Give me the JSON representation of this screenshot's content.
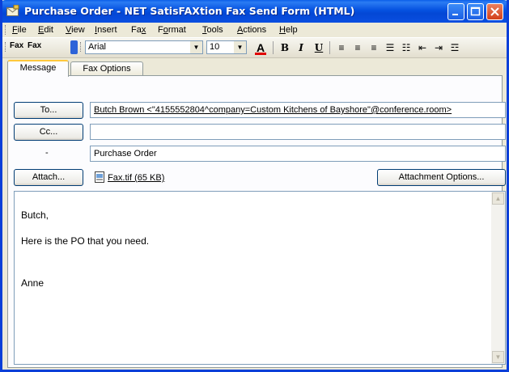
{
  "window": {
    "title": "Purchase Order - NET SatisFAXtion Fax Send Form (HTML)"
  },
  "menu": [
    {
      "label": "File",
      "key": "F",
      "rest": "ile"
    },
    {
      "label": "Edit",
      "key": "E",
      "rest": "dit"
    },
    {
      "label": "View",
      "key": "V",
      "rest": "iew"
    },
    {
      "label": "Insert",
      "key": "I",
      "rest": "nsert"
    },
    {
      "label": "Fax",
      "pre": "Fa",
      "key": "x",
      "rest": ""
    },
    {
      "label": "Format",
      "pre": "F",
      "key": "o",
      "rest": "rmat"
    },
    {
      "label": "Tools",
      "key": "T",
      "rest": "ools"
    },
    {
      "label": "Actions",
      "key": "A",
      "rest": "ctions"
    },
    {
      "label": "Help",
      "key": "H",
      "rest": "elp"
    }
  ],
  "toolbar": {
    "fax_send_label": "Fax",
    "fax_label": "Fax",
    "font_name": "Arial",
    "font_size": "10",
    "bold": "B",
    "italic": "I",
    "underline": "U"
  },
  "tabs": [
    {
      "label": "Message",
      "active": true
    },
    {
      "label": "Fax Options",
      "active": false
    }
  ],
  "form": {
    "to_button": "To...",
    "to_value": "Butch Brown <\"4155552804^company=Custom Kitchens of Bayshore\"@conference.room>",
    "cc_button": "Cc...",
    "cc_value": "",
    "subject_label": "-",
    "subject_value": "Purchase Order",
    "attach_button": "Attach...",
    "attachment_name": "Fax.tif (65 KB)",
    "attachment_options_button": "Attachment Options..."
  },
  "message": {
    "lines": [
      "Butch,",
      "Here is the PO that you need.",
      "Anne"
    ]
  },
  "colors": {
    "titlebar": "#0a5fe8",
    "window_bg": "#ece9d8",
    "tab_highlight": "#ffc83c"
  }
}
